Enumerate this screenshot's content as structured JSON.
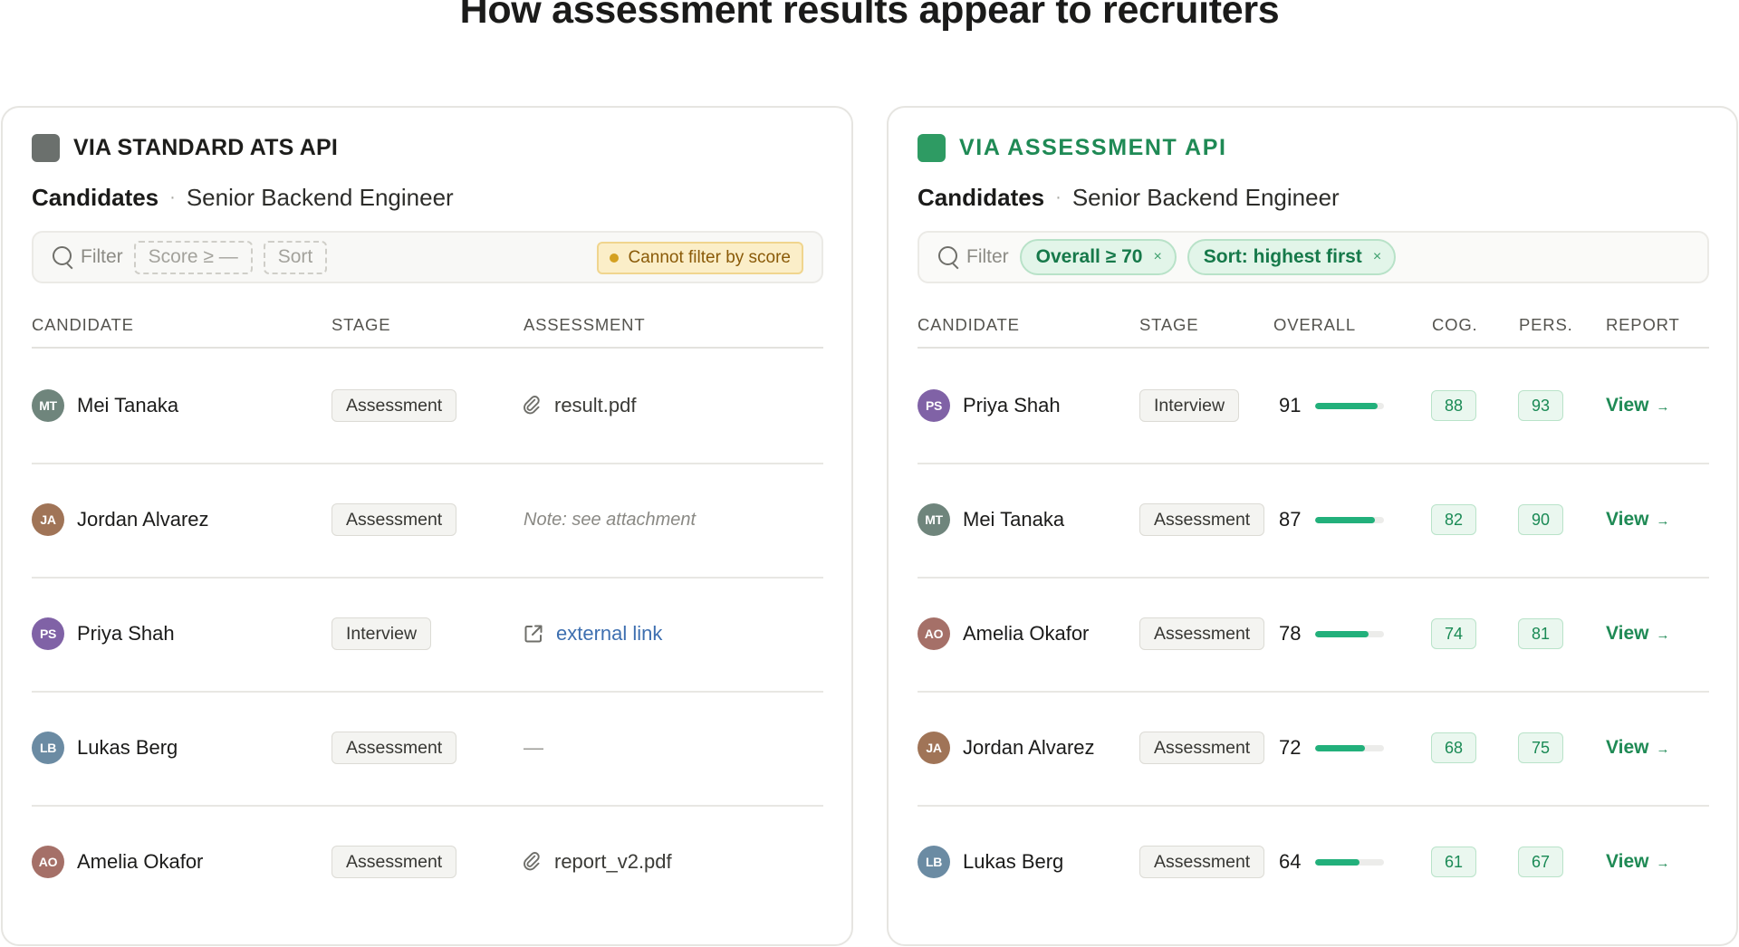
{
  "title": "How assessment results appear to recruiters",
  "left_panel": {
    "label": "VIA STANDARD ATS API",
    "crumb_strong": "Candidates",
    "crumb_separator": "·",
    "crumb_role": "Senior Backend Engineer",
    "filter_label": "Filter",
    "ghost_chips": [
      "Score ≥ —",
      "Sort"
    ],
    "warning": "Cannot filter by score",
    "columns": [
      "CANDIDATE",
      "STAGE",
      "ASSESSMENT"
    ],
    "rows": [
      {
        "initials": "MT",
        "name": "Mei Tanaka",
        "stage": "Assessment",
        "assessment": "result.pdf",
        "kind": "file"
      },
      {
        "initials": "JA",
        "name": "Jordan Alvarez",
        "stage": "Assessment",
        "assessment": "Note: see attachment",
        "kind": "note"
      },
      {
        "initials": "PS",
        "name": "Priya Shah",
        "stage": "Interview",
        "assessment": "external link",
        "kind": "link"
      },
      {
        "initials": "LB",
        "name": "Lukas Berg",
        "stage": "Assessment",
        "assessment": "—",
        "kind": "none"
      },
      {
        "initials": "AO",
        "name": "Amelia Okafor",
        "stage": "Assessment",
        "assessment": "report_v2.pdf",
        "kind": "file"
      }
    ]
  },
  "right_panel": {
    "label": "VIA ASSESSMENT API",
    "crumb_strong": "Candidates",
    "crumb_separator": "·",
    "crumb_role": "Senior Backend Engineer",
    "filter_label": "Filter",
    "chips": [
      {
        "label": "Overall ≥ 70",
        "remove": "×"
      },
      {
        "label": "Sort: highest first",
        "remove": "×"
      }
    ],
    "columns": [
      "CANDIDATE",
      "STAGE",
      "OVERALL",
      "COG.",
      "PERS.",
      "REPORT"
    ],
    "view_label": "View",
    "view_arrow": "→",
    "rows": [
      {
        "initials": "PS",
        "name": "Priya Shah",
        "stage": "Interview",
        "overall": 91,
        "cog": 88,
        "pers": 93
      },
      {
        "initials": "MT",
        "name": "Mei Tanaka",
        "stage": "Assessment",
        "overall": 87,
        "cog": 82,
        "pers": 90
      },
      {
        "initials": "AO",
        "name": "Amelia Okafor",
        "stage": "Assessment",
        "overall": 78,
        "cog": 74,
        "pers": 81
      },
      {
        "initials": "JA",
        "name": "Jordan Alvarez",
        "stage": "Assessment",
        "overall": 72,
        "cog": 68,
        "pers": 75
      },
      {
        "initials": "LB",
        "name": "Lukas Berg",
        "stage": "Assessment",
        "overall": 64,
        "cog": 61,
        "pers": 67
      }
    ]
  },
  "colors": {
    "accent_green": "#1f8a55",
    "bar_green": "#22b07b",
    "warning_bg": "#fbeec8",
    "link_blue": "#3e6fb0"
  }
}
